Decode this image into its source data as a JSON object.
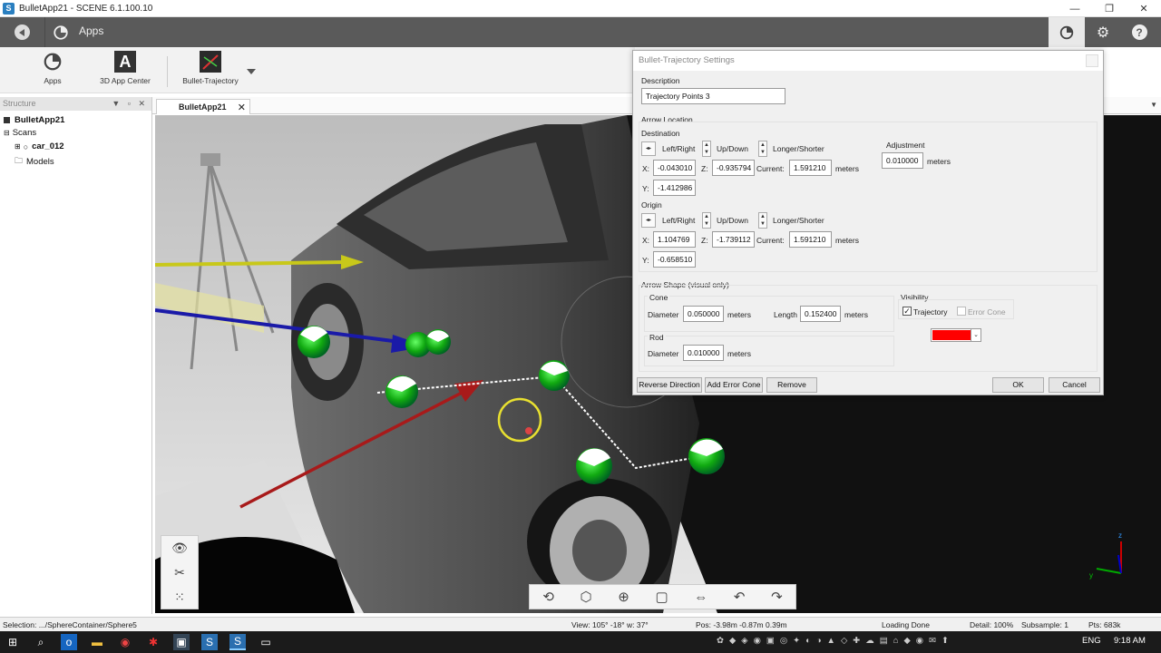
{
  "window": {
    "title": "BulletApp21 - SCENE 6.1.100.10",
    "app_icon": "S",
    "buttons": [
      "—",
      "❐",
      "✕"
    ]
  },
  "nav": {
    "title": "Apps"
  },
  "ribbon": {
    "items": [
      {
        "label": "Apps"
      },
      {
        "label": "3D App Center"
      },
      {
        "label": "Bullet-Trajectory"
      }
    ]
  },
  "structure": {
    "header": "Structure",
    "tree": [
      {
        "label": "BulletApp21"
      },
      {
        "label": "Scans"
      },
      {
        "label": "car_012"
      },
      {
        "label": "Models"
      }
    ]
  },
  "viewport_tab": {
    "label": "BulletApp21"
  },
  "dialog": {
    "title": "Bullet-Trajectory Settings",
    "description_label": "Description",
    "description_value": "Trajectory Points 3",
    "arrow_location": "Arrow Location",
    "destination": "Destination",
    "origin": "Origin",
    "left_right": "Left/Right",
    "up_down": "Up/Down",
    "longer_shorter": "Longer/Shorter",
    "adjustment_label": "Adjustment",
    "adjustment_value": "0.010000",
    "meters": "meters",
    "x_label": "X:",
    "y_label": "Y:",
    "z_label": "Z:",
    "current_label": "Current:",
    "dest": {
      "x": "-0.043010",
      "y": "-1.412986",
      "z": "-0.935794",
      "current": "1.591210"
    },
    "orig": {
      "x": "1.104769",
      "y": "-0.658510",
      "z": "-1.739112",
      "current": "1.591210"
    },
    "arrow_shape": "Arrow Shape (visual only)",
    "cone": "Cone",
    "rod": "Rod",
    "diameter_label": "Diameter",
    "length_label": "Length",
    "cone_diameter": "0.050000",
    "cone_length": "0.152400",
    "rod_diameter": "0.010000",
    "visibility": "Visibility",
    "trajectory_label": "Trajectory",
    "trajectory_checked": "✓",
    "error_cone_label": "Error Cone",
    "color": "#ff0000",
    "buttons": {
      "reverse": "Reverse Direction",
      "add_error_cone": "Add Error Cone",
      "remove": "Remove",
      "ok": "OK",
      "cancel": "Cancel"
    }
  },
  "status": {
    "selection": "Selection: .../SphereContainer/Sphere5",
    "view": "View: 105° -18° w: 37°",
    "pos": "Pos: -3.98m -0.87m 0.39m",
    "loading": "Loading Done",
    "detail": "Detail: 100%",
    "subsample": "Subsample:  1",
    "pts": "Pts: 683k"
  },
  "taskbar": {
    "lang": "ENG",
    "time": "9:18 AM"
  }
}
